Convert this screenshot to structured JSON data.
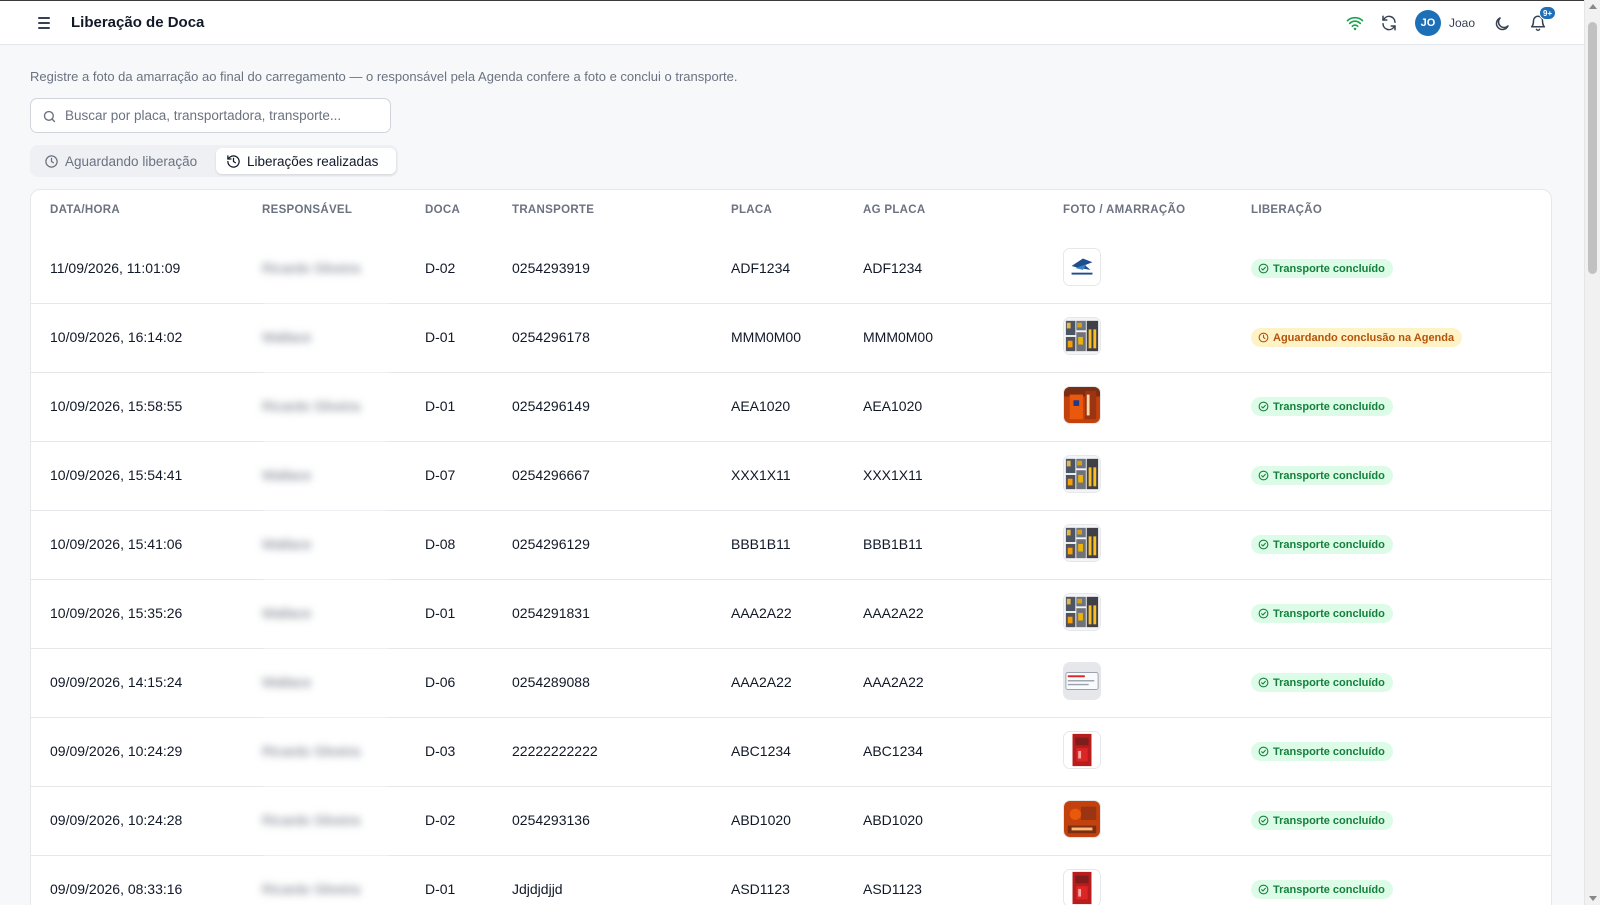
{
  "header": {
    "title": "Liberação de Doca",
    "user": {
      "initials": "JO",
      "name": "Joao"
    },
    "notifications_badge": "9+"
  },
  "description": "Registre a foto da amarração ao final do carregamento — o responsável pela Agenda confere a foto e conclui o transporte.",
  "search": {
    "placeholder": "Buscar por placa, transportadora, transporte...",
    "value": ""
  },
  "tabs": [
    {
      "label": "Aguardando liberação",
      "active": false
    },
    {
      "label": "Liberações realizadas",
      "active": true
    }
  ],
  "table": {
    "columns": [
      "DATA/HORA",
      "RESPONSÁVEL",
      "DOCA",
      "TRANSPORTE",
      "PLACA",
      "AG PLACA",
      "FOTO / AMARRAÇÃO",
      "LIBERAÇÃO"
    ],
    "rows": [
      {
        "datetime": "11/09/2026, 11:01:09",
        "responsavel": "Ricardo Silveira",
        "doca": "D-02",
        "transporte": "0254293919",
        "placa": "ADF1234",
        "ag_placa": "ADF1234",
        "photo": "logo",
        "status": "Transporte concluído",
        "status_kind": "green"
      },
      {
        "datetime": "10/09/2026, 16:14:02",
        "responsavel": "Wallace",
        "doca": "D-01",
        "transporte": "0254296178",
        "placa": "MMM0M00",
        "ag_placa": "MMM0M00",
        "photo": "collage",
        "status": "Aguardando conclusão na Agenda",
        "status_kind": "amber"
      },
      {
        "datetime": "10/09/2026, 15:58:55",
        "responsavel": "Ricardo Silveira",
        "doca": "D-01",
        "transporte": "0254296149",
        "placa": "AEA1020",
        "ag_placa": "AEA1020",
        "photo": "orange",
        "status": "Transporte concluído",
        "status_kind": "green"
      },
      {
        "datetime": "10/09/2026, 15:54:41",
        "responsavel": "Wallace",
        "doca": "D-07",
        "transporte": "0254296667",
        "placa": "XXX1X11",
        "ag_placa": "XXX1X11",
        "photo": "collage",
        "status": "Transporte concluído",
        "status_kind": "green"
      },
      {
        "datetime": "10/09/2026, 15:41:06",
        "responsavel": "Wallace",
        "doca": "D-08",
        "transporte": "0254296129",
        "placa": "BBB1B11",
        "ag_placa": "BBB1B11",
        "photo": "collage",
        "status": "Transporte concluído",
        "status_kind": "green"
      },
      {
        "datetime": "10/09/2026, 15:35:26",
        "responsavel": "Wallace",
        "doca": "D-01",
        "transporte": "0254291831",
        "placa": "AAA2A22",
        "ag_placa": "AAA2A22",
        "photo": "collage",
        "status": "Transporte concluído",
        "status_kind": "green"
      },
      {
        "datetime": "09/09/2026, 14:15:24",
        "responsavel": "Wallace",
        "doca": "D-06",
        "transporte": "0254289088",
        "placa": "AAA2A22",
        "ag_placa": "AAA2A22",
        "photo": "screen",
        "status": "Transporte concluído",
        "status_kind": "green"
      },
      {
        "datetime": "09/09/2026, 10:24:29",
        "responsavel": "Ricardo Silveira",
        "doca": "D-03",
        "transporte": "22222222222",
        "placa": "ABC1234",
        "ag_placa": "ABC1234",
        "photo": "red",
        "status": "Transporte concluído",
        "status_kind": "green"
      },
      {
        "datetime": "09/09/2026, 10:24:28",
        "responsavel": "Ricardo Silveira",
        "doca": "D-02",
        "transporte": "0254293136",
        "placa": "ABD1020",
        "ag_placa": "ABD1020",
        "photo": "orange2",
        "status": "Transporte concluído",
        "status_kind": "green"
      },
      {
        "datetime": "09/09/2026, 08:33:16",
        "responsavel": "Ricardo Silveira",
        "doca": "D-01",
        "transporte": "Jdjdjdjjd",
        "placa": "ASD1123",
        "ag_placa": "ASD1123",
        "photo": "red",
        "status": "Transporte concluído",
        "status_kind": "green"
      }
    ]
  },
  "colors": {
    "accent": "#1d6fb8",
    "success_bg": "#dcfce7",
    "success_fg": "#15803d",
    "warning_bg": "#fef3c7",
    "warning_fg": "#b45309",
    "wifi": "#16a34a"
  }
}
